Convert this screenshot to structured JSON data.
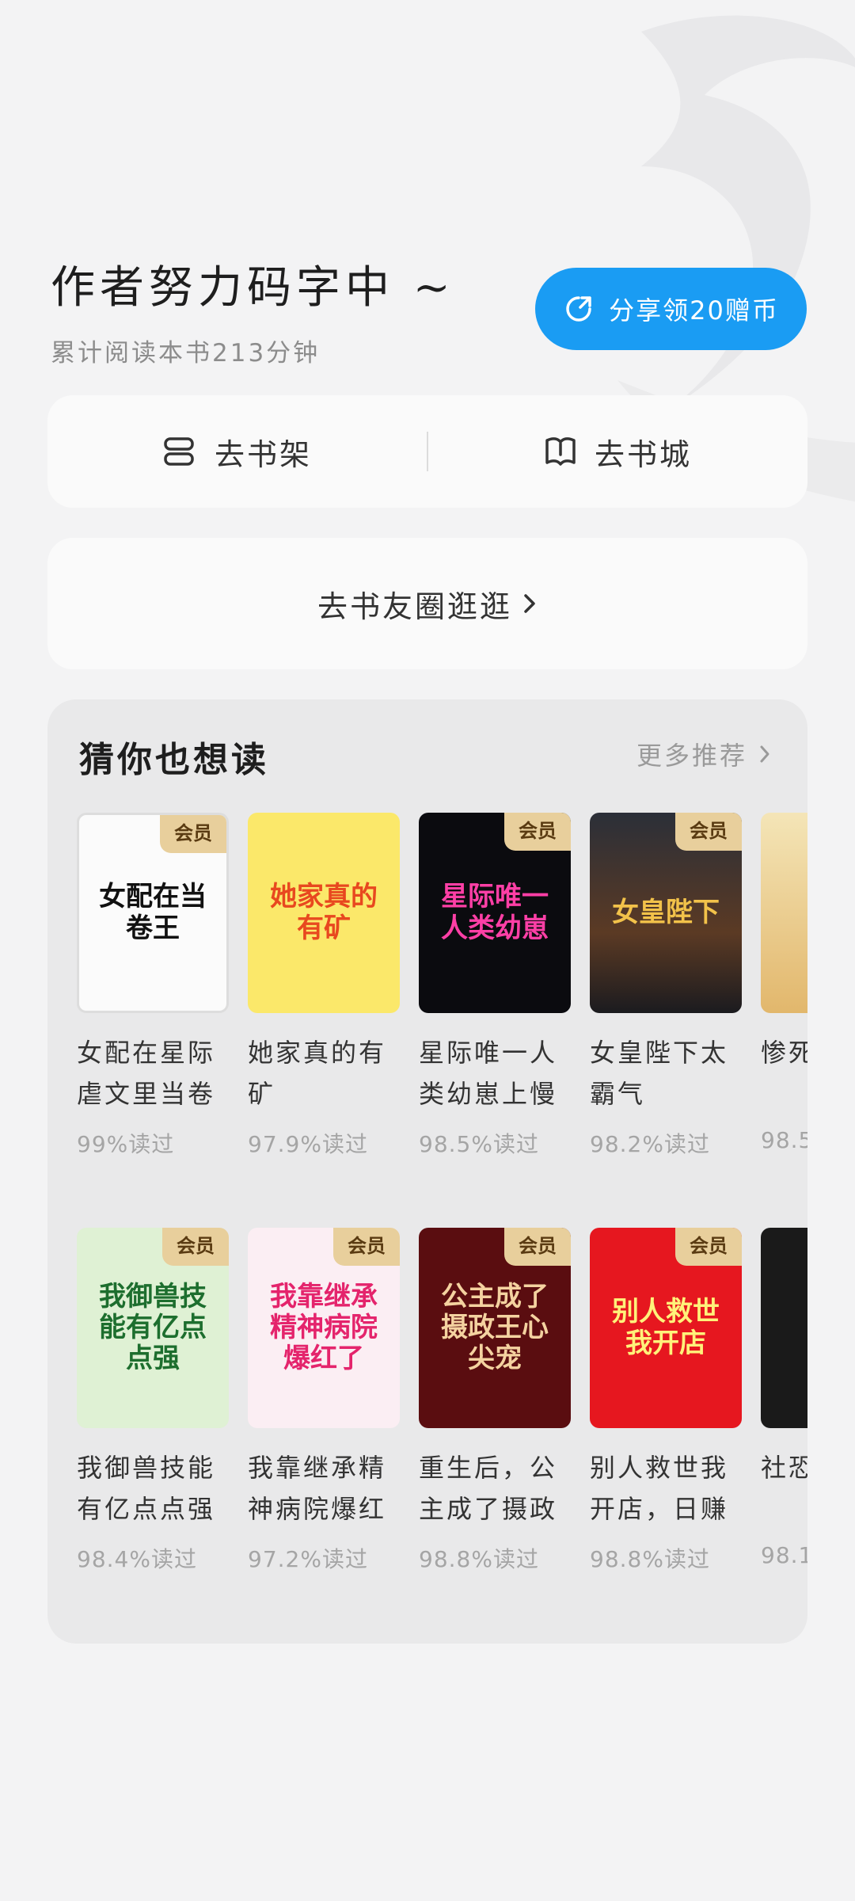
{
  "header": {
    "title": "作者努力码字中 ~",
    "subtitle": "累计阅读本书213分钟"
  },
  "share": {
    "label": "分享领20赠币"
  },
  "nav": {
    "bookshelf": "去书架",
    "bookstore": "去书城"
  },
  "circle": {
    "label": "去书友圈逛逛"
  },
  "recommend": {
    "title": "猜你也想读",
    "more": "更多推荐",
    "badge": "会员",
    "row1": [
      {
        "title": "女配在星际虐文里当卷",
        "read": "99%读过",
        "cover_text": "女配在当卷王"
      },
      {
        "title": "她家真的有矿",
        "read": "97.9%读过",
        "cover_text": "她家真的有矿"
      },
      {
        "title": "星际唯一人类幼崽上慢",
        "read": "98.5%读过",
        "cover_text": "星际唯一人类幼崽"
      },
      {
        "title": "女皇陛下太霸气",
        "read": "98.2%读过",
        "cover_text": "女皇陛下"
      },
      {
        "title": "惨死三任",
        "read": "98.5",
        "cover_text": ""
      }
    ],
    "row2": [
      {
        "title": "我御兽技能有亿点点强",
        "read": "98.4%读过",
        "cover_text": "我御兽技能有亿点点强"
      },
      {
        "title": "我靠继承精神病院爆红",
        "read": "97.2%读过",
        "cover_text": "我靠继承精神病院爆红了"
      },
      {
        "title": "重生后，公主成了摄政",
        "read": "98.8%读过",
        "cover_text": "公主成了摄政王心尖宠"
      },
      {
        "title": "别人救世我开店，日赚",
        "read": "98.8%读过",
        "cover_text": "别人救世我开店"
      },
      {
        "title": "社恐界沉",
        "read": "98.1",
        "cover_text": ""
      }
    ]
  }
}
